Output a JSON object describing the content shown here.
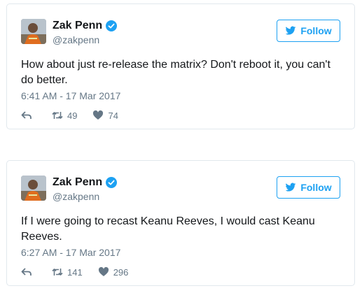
{
  "tweets": [
    {
      "author_name": "Zak Penn",
      "handle": "@zakpenn",
      "follow_label": "Follow",
      "text": "How about just re-release the matrix? Don't reboot it, you can't do better.",
      "timestamp": "6:41 AM - 17 Mar 2017",
      "retweets": "49",
      "likes": "74"
    },
    {
      "author_name": "Zak Penn",
      "handle": "@zakpenn",
      "follow_label": "Follow",
      "text": "If I were going to recast Keanu Reeves, I would cast Keanu Reeves.",
      "timestamp": "6:27 AM - 17 Mar 2017",
      "retweets": "141",
      "likes": "296"
    }
  ],
  "colors": {
    "accent": "#1da1f2",
    "muted": "#657786",
    "border": "#e1e8ed",
    "text": "#14171a"
  },
  "icons": {
    "verified": "verified-badge-icon",
    "follow": "twitter-bird-icon",
    "reply": "reply-icon",
    "retweet": "retweet-icon",
    "like": "heart-icon"
  }
}
